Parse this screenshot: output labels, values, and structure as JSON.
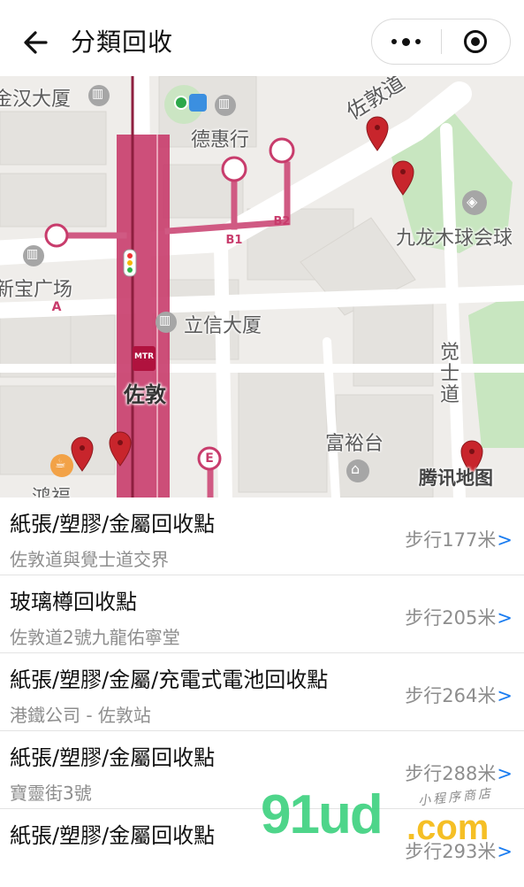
{
  "header": {
    "title": "分類回收",
    "back_icon": "arrow-left-icon",
    "more_icon": "more-dots-icon",
    "close_icon": "target-circle-icon"
  },
  "map": {
    "labels": {
      "jinhan": "金汉大厦",
      "dehui": "德惠行",
      "zuodun_road": "佐敦道",
      "kowloon_cricket": "九龙木球会球",
      "xinbao": "新宝广场",
      "lixin": "立信大厦",
      "zuodun_station": "佐敦",
      "jueshi_1": "觉",
      "jueshi_2": "士",
      "jueshi_3": "道",
      "fuyu": "富裕台",
      "tencent": "腾讯地图",
      "hongfu": "鸿福"
    },
    "exits": {
      "a": "A",
      "b1": "B1",
      "b2": "B2",
      "e": "E"
    },
    "mtr_logo": "MTR"
  },
  "items": [
    {
      "name": "紙張/塑膠/金屬回收點",
      "address": "佐敦道與覺士道交界",
      "distance": "步行177米",
      "arrow": ">"
    },
    {
      "name": "玻璃樽回收點",
      "address": "佐敦道2號九龍佑寧堂",
      "distance": "步行205米",
      "arrow": ">"
    },
    {
      "name": "紙張/塑膠/金屬/充電式電池回收點",
      "address": "港鐵公司 - 佐敦站",
      "distance": "步行264米",
      "arrow": ">"
    },
    {
      "name": "紙張/塑膠/金屬回收點",
      "address": "寶靈街3號",
      "distance": "步行288米",
      "arrow": ">"
    },
    {
      "name": "紙張/塑膠/金屬回收點",
      "address": "",
      "distance": "步行293米",
      "arrow": ">"
    }
  ],
  "watermark": {
    "main": "91ud",
    "domain": ".com",
    "small": "小程序商店"
  },
  "colors": {
    "mtr_line": "#c83c6c",
    "mtr_exit": "#d05a83",
    "pin": "#c8252c",
    "park": "#c8e6c0",
    "link": "#1a7cf0"
  }
}
